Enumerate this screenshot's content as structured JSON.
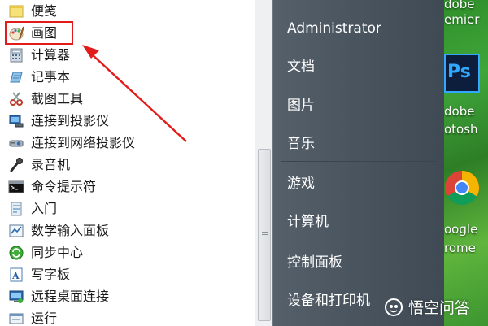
{
  "program_list": {
    "items": [
      {
        "label": "便笺",
        "icon": "notes-icon"
      },
      {
        "label": "画图",
        "icon": "paint-icon"
      },
      {
        "label": "计算器",
        "icon": "calculator-icon"
      },
      {
        "label": "记事本",
        "icon": "notepad-icon"
      },
      {
        "label": "截图工具",
        "icon": "snipping-tool-icon"
      },
      {
        "label": "连接到投影仪",
        "icon": "projector-icon"
      },
      {
        "label": "连接到网络投影仪",
        "icon": "network-projector-icon"
      },
      {
        "label": "录音机",
        "icon": "microphone-icon"
      },
      {
        "label": "命令提示符",
        "icon": "command-prompt-icon"
      },
      {
        "label": "入门",
        "icon": "getting-started-icon"
      },
      {
        "label": "数学输入面板",
        "icon": "math-input-icon"
      },
      {
        "label": "同步中心",
        "icon": "sync-icon"
      },
      {
        "label": "写字板",
        "icon": "wordpad-icon"
      },
      {
        "label": "远程桌面连接",
        "icon": "remote-desktop-icon"
      },
      {
        "label": "运行",
        "icon": "run-icon"
      }
    ],
    "highlighted_item": "画图"
  },
  "right_pane": {
    "items": [
      "Administrator",
      "文档",
      "图片",
      "音乐",
      "游戏",
      "计算机",
      "控制面板",
      "设备和打印机"
    ]
  },
  "desktop": {
    "icon_texts": [
      "dobe",
      "emier",
      "Ps",
      "dobe",
      "otosh",
      "oogle",
      "rome"
    ]
  },
  "watermark": {
    "text": "悟空问答"
  },
  "colors": {
    "highlight": "#e31b1b",
    "pane": "#4b5660",
    "desktop": "#3fa63a"
  }
}
